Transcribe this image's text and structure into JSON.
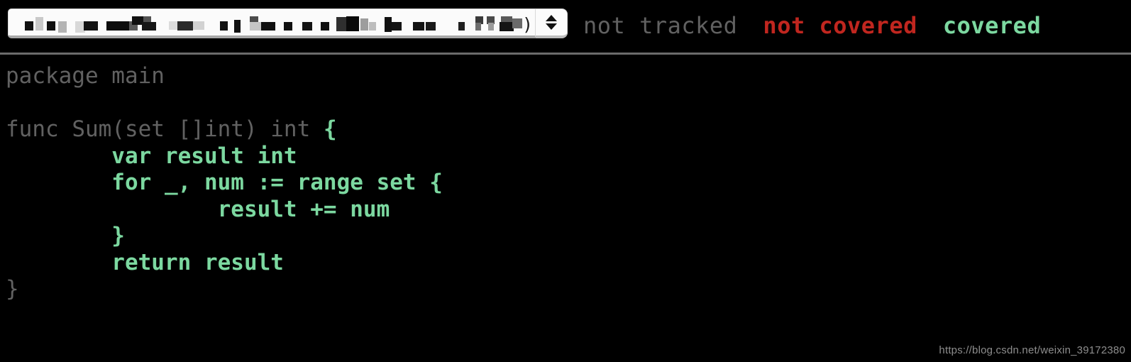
{
  "toolbar": {
    "file_select": {
      "name": "file-selector",
      "selected_value_redacted": true,
      "trailing_text": ")",
      "spinner_up_icon": "triangle-up-icon",
      "spinner_down_icon": "triangle-down-icon"
    },
    "legend": [
      {
        "label": "not tracked",
        "color": "#616161",
        "state": "not-tracked"
      },
      {
        "label": "not covered",
        "color": "#c0261f",
        "state": "not-covered"
      },
      {
        "label": "covered",
        "color": "#7cd8a0",
        "state": "covered"
      }
    ]
  },
  "source": {
    "language": "go",
    "lines": [
      [
        {
          "t": "package main",
          "c": "g0"
        }
      ],
      [
        {
          "t": "",
          "c": "g0"
        }
      ],
      [
        {
          "t": "func Sum(set []int) int ",
          "c": "g0"
        },
        {
          "t": "{",
          "c": "g1"
        }
      ],
      [
        {
          "t": "        var result int",
          "c": "g1"
        }
      ],
      [
        {
          "t": "        for _, num := range set {",
          "c": "g1"
        }
      ],
      [
        {
          "t": "                result += num",
          "c": "g1"
        }
      ],
      [
        {
          "t": "        }",
          "c": "g1"
        }
      ],
      [
        {
          "t": "        return result",
          "c": "g1"
        }
      ],
      [
        {
          "t": "}",
          "c": "g0"
        }
      ]
    ]
  },
  "watermark": {
    "text": "https://blog.csdn.net/weixin_39172380"
  }
}
